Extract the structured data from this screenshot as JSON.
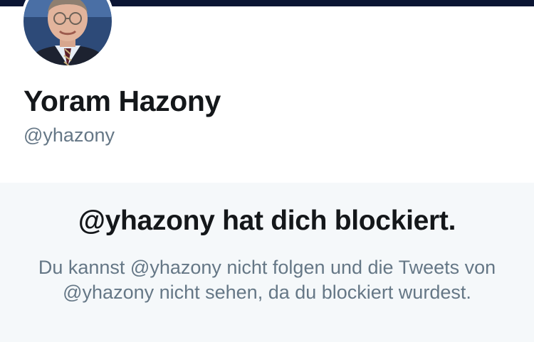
{
  "colors": {
    "banner": "#0b1533",
    "text_primary": "#14171a",
    "text_secondary": "#657786",
    "panel_background": "#f5f8fa"
  },
  "profile": {
    "display_name": "Yoram Hazony",
    "handle": "@yhazony",
    "avatar_icon": "profile-photo"
  },
  "blocked_notice": {
    "title": "@yhazony hat dich blockiert.",
    "description": "Du kannst @yhazony nicht folgen und die Tweets von @yhazony nicht sehen, da du blockiert wurdest."
  }
}
